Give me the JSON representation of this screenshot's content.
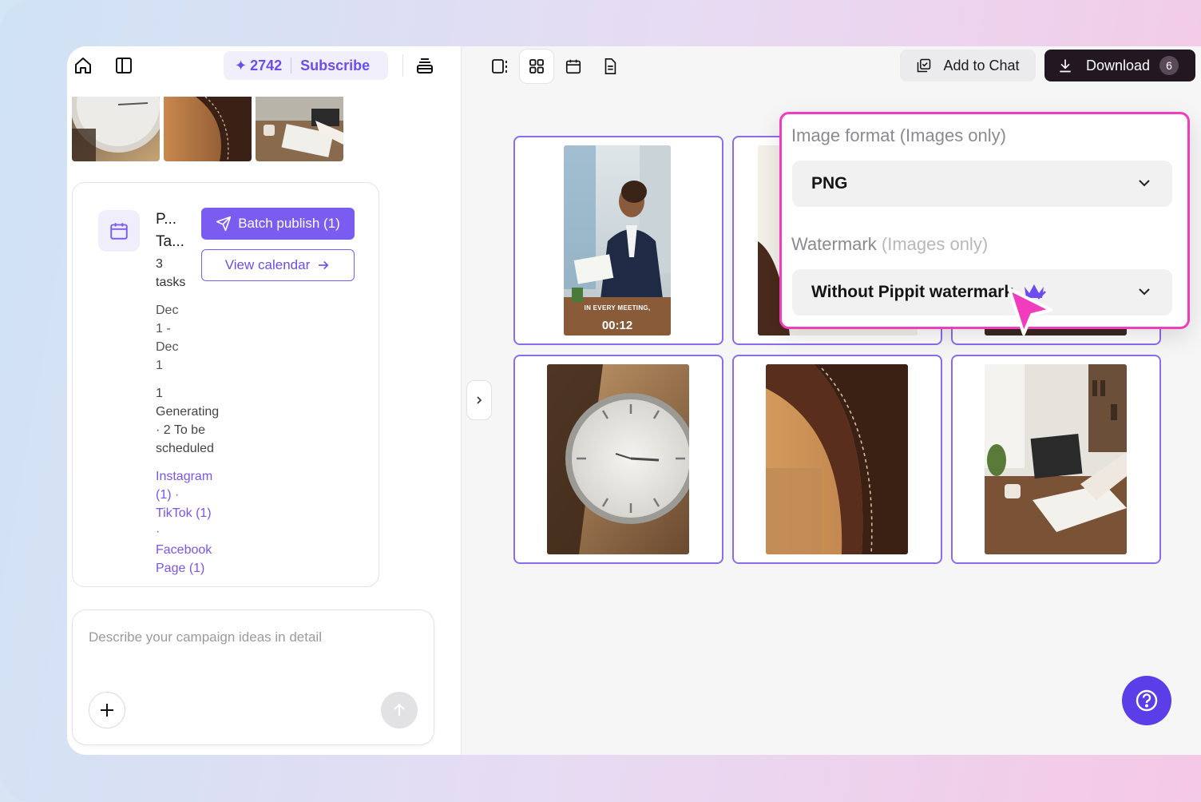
{
  "header": {
    "credits": "2742",
    "subscribe_label": "Subscribe",
    "add_to_chat_label": "Add to Chat",
    "download_label": "Download",
    "download_count": "6"
  },
  "task_card": {
    "title_line1": "P...",
    "title_line2": "Ta...",
    "count_lines": [
      "3",
      "tasks"
    ],
    "date_lines": [
      "Dec",
      "1 -",
      "Dec",
      "1"
    ],
    "status_lines": [
      "1",
      "Generating",
      "· 2 To be",
      "scheduled"
    ],
    "platform_lines": [
      "Instagram",
      "(1) ·",
      "TikTok (1)",
      "·",
      "Facebook",
      "Page (1)"
    ],
    "batch_publish_label": "Batch publish (1)",
    "view_calendar_label": "View calendar"
  },
  "prompt": {
    "placeholder": "Describe your campaign ideas in detail"
  },
  "grid": {
    "video_overlay_text": "IN EVERY MEETING,",
    "video_duration": "00:12"
  },
  "download_menu": {
    "image_format_label": "Image format (Images only)",
    "image_format_value": "PNG",
    "watermark_label": "Watermark",
    "watermark_note": "(Images only)",
    "watermark_value": "Without Pippit watermark"
  },
  "colors": {
    "accent": "#7b5cf0",
    "highlight": "#f03cbd",
    "download_bg": "#231722"
  }
}
